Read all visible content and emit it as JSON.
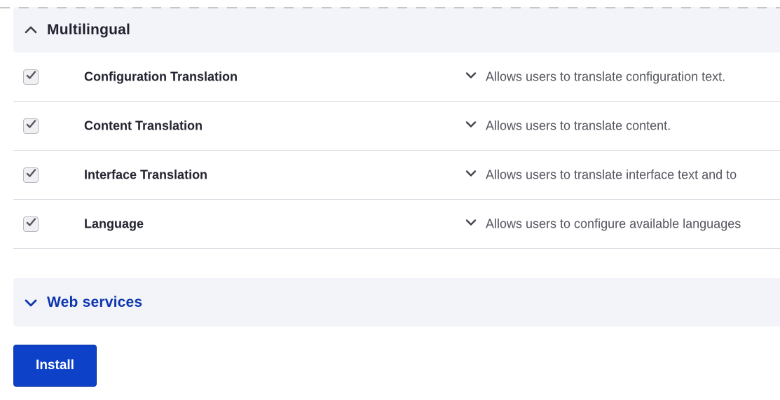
{
  "sections": [
    {
      "id": "multilingual",
      "label": "Multilingual",
      "expanded": true,
      "modules": [
        {
          "name": "Configuration Translation",
          "checked": true,
          "description": "Allows users to translate configuration text."
        },
        {
          "name": "Content Translation",
          "checked": true,
          "description": "Allows users to translate content."
        },
        {
          "name": "Interface Translation",
          "checked": true,
          "description": "Allows users to translate interface text and to"
        },
        {
          "name": "Language",
          "checked": true,
          "description": "Allows users to configure available languages"
        }
      ]
    },
    {
      "id": "web-services",
      "label": "Web services",
      "expanded": false
    }
  ],
  "install_button": {
    "label": "Install"
  },
  "icons": {
    "section_expanded": "chevron-up-icon",
    "section_collapsed": "chevron-down-icon",
    "description_toggle": "chevron-down-icon",
    "checkbox_state": "check-icon"
  },
  "colors": {
    "band_background": "#f3f4f9",
    "divider": "#d4d5dc",
    "heading_text": "#222330",
    "collapsed_heading_text": "#0d36ae",
    "description_text": "#55565f",
    "button_background": "#0d41c8",
    "button_text": "#ffffff"
  }
}
